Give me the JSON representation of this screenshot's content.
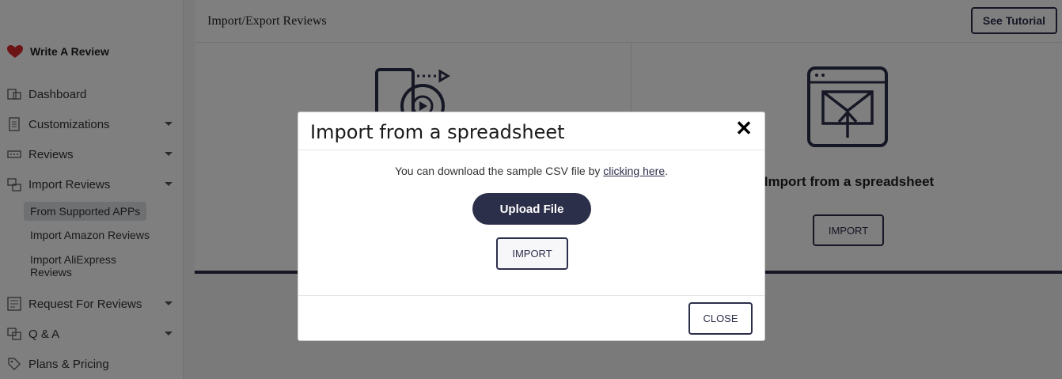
{
  "sidebar": {
    "brand": "Write A Review",
    "items": [
      {
        "label": "Dashboard",
        "icon": "dashboard-icon",
        "has_caret": false
      },
      {
        "label": "Customizations",
        "icon": "document-icon",
        "has_caret": true
      },
      {
        "label": "Reviews",
        "icon": "reviews-icon",
        "has_caret": true
      },
      {
        "label": "Import Reviews",
        "icon": "import-icon",
        "has_caret": true
      },
      {
        "label": "Request For Reviews",
        "icon": "request-icon",
        "has_caret": true
      },
      {
        "label": "Q & A",
        "icon": "qa-icon",
        "has_caret": true
      },
      {
        "label": "Plans & Pricing",
        "icon": "tag-icon",
        "has_caret": false
      }
    ],
    "sub_items": [
      {
        "label": "From Supported APPs",
        "active": true
      },
      {
        "label": "Import Amazon Reviews",
        "active": false
      },
      {
        "label": "Import AliExpress Reviews",
        "active": false
      }
    ]
  },
  "header": {
    "title": "Import/Export Reviews",
    "tutorial_label": "See Tutorial"
  },
  "cards": {
    "right_title": "Import from a spreadsheet",
    "right_button": "IMPORT"
  },
  "modal": {
    "title": "Import from a spreadsheet",
    "close_symbol": "✕",
    "text": "You can download the sample CSV file by",
    "link_text": "clicking here",
    "text_suffix": ".",
    "upload_label": "Upload File",
    "import_label": "IMPORT",
    "close_label": "CLOSE"
  },
  "colors": {
    "accent": "#2c2f4a",
    "heart": "#d9262c",
    "overlay": "rgba(0,0,0,0.5)"
  }
}
